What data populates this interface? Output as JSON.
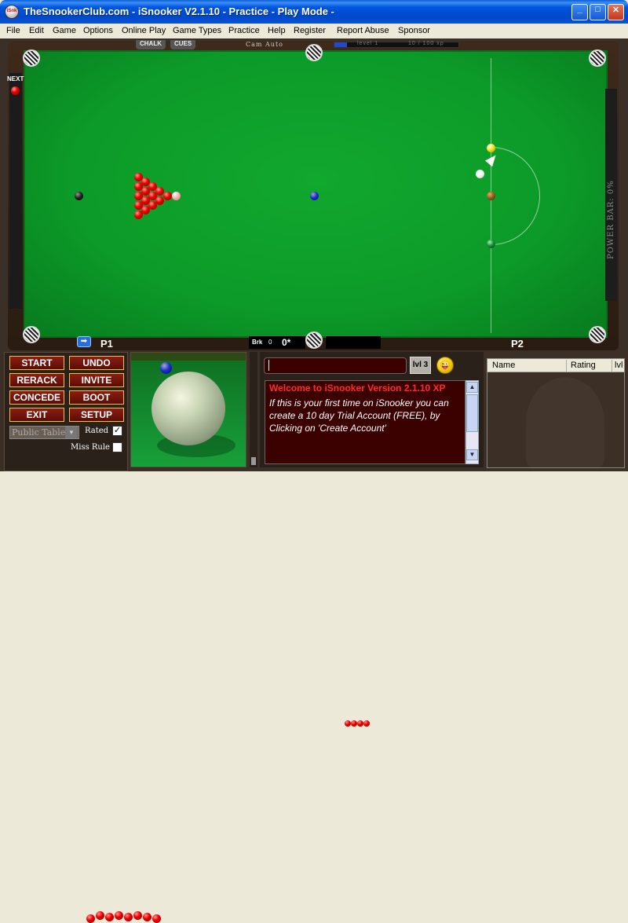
{
  "window": {
    "title": "TheSnookerClub.com - iSnooker V2.1.10 -  Practice - Play Mode -",
    "icon_text": "iSnk",
    "buttons": {
      "minimize": "_",
      "maximize": "□",
      "close": "✕"
    }
  },
  "menu": [
    "File",
    "Edit",
    "Game",
    "Options",
    "Online Play",
    "Game Types",
    "Practice",
    "Help",
    "Register",
    "Report Abuse",
    "Sponsor"
  ],
  "table": {
    "tabs": {
      "chalk": "CHALK",
      "cues": "CUES"
    },
    "camera": "Cam Auto",
    "level_text": "level 1",
    "xp_text": "10 / 100 xp",
    "xp_progress": 0.1,
    "next_label": "NEXT",
    "power_label": "POWER BAR: 0%",
    "players": {
      "p1": "P1",
      "p2": "P2",
      "turn_arrow": "➡"
    },
    "break": {
      "label": "Brk",
      "value": "0",
      "score_p1": "0*"
    }
  },
  "controls": {
    "start": "START",
    "undo": "UNDO",
    "rerack": "RERACK",
    "invite": "INVITE",
    "concede": "CONCEDE",
    "boot": "BOOT",
    "exit": "EXIT",
    "setup": "SETUP",
    "table_type": "Public Table",
    "rated_label": "Rated",
    "rated_checked": "✓",
    "miss_rule_label": "Miss Rule"
  },
  "chat": {
    "level_button": "lvl 3",
    "smiley": "😜",
    "welcome": "Welcome to iSnooker Version 2.1.10 XP",
    "info": "If this is your first time on iSnooker you can create a 10 day Trial Account (FREE), by Clicking on 'Create Account'"
  },
  "players_list": {
    "columns": [
      "Name",
      "Rating",
      "lvl"
    ]
  },
  "colors": {
    "cloth": "#0c9a28",
    "button_bg": "#8a1e12",
    "button_border": "#f1c040",
    "titlebar": "#0048c8"
  }
}
